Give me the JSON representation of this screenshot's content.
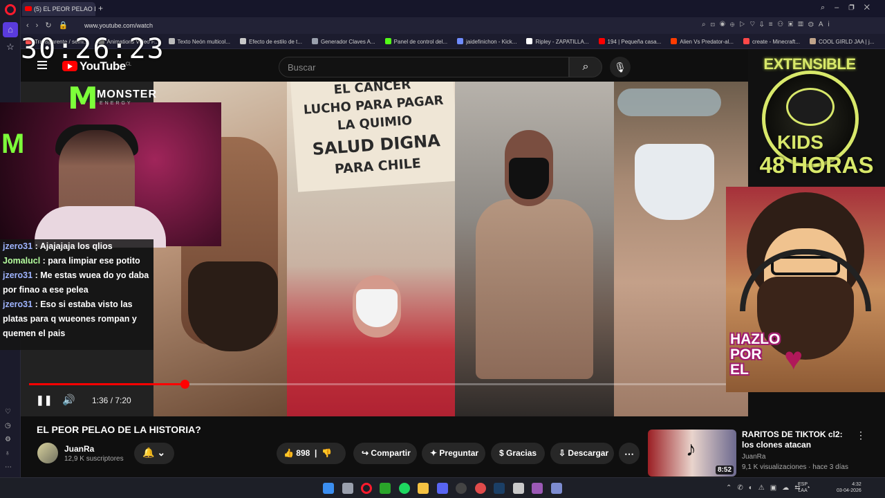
{
  "browser": {
    "tab_title": "(5) EL PEOR PELAO DE",
    "url": "www.youtube.com/watch",
    "bookmarks": [
      "Transparente / semi...",
      "Animations Video F...",
      "Texto Neón multicol...",
      "Efecto de estilo de t...",
      "Generador Claves A...",
      "Panel de control del...",
      "jaidefinichon - Kick...",
      "Ripley - ZAPATILLA...",
      "194 | Pequeña casa...",
      "Alien Vs Predator-al...",
      "create - Minecraft...",
      "COOL GIRLD JAA | j..."
    ],
    "ai_label": "Ai"
  },
  "stream": {
    "timer": "30:26:23",
    "monster_brand": "MONSTER",
    "monster_sub": "ENERGY",
    "chat": [
      {
        "user": "jzero31",
        "msg": "Ajajajaja los qlios"
      },
      {
        "user": "Jomalucl",
        "msg": "para limpiar ese potito"
      },
      {
        "user": "jzero31",
        "msg": "Me estas wuea do yo daba por finao a ese pelea"
      },
      {
        "user": "jzero31",
        "msg": "Eso si estaba visto las platas para q wueones rompan y quemen el pais"
      }
    ],
    "promo": {
      "top": "EXTENSIBLE",
      "middle": "KIDS",
      "bottom": "48 HORAS"
    },
    "hazlo": [
      "HAZLO",
      "POR",
      "EL"
    ]
  },
  "youtube": {
    "logo": "YouTube",
    "logo_country": "CL",
    "search_placeholder": "Buscar"
  },
  "video": {
    "sign_lines": [
      "EL CANCER",
      "LUCHO PARA PAGAR",
      "LA QUIMIO",
      "SALUD DIGNA",
      "PARA CHILE"
    ],
    "time": "1:36 / 7:20",
    "progress": 0.218,
    "title": "EL PEOR PELAO DE LA HISTORIA?",
    "channel": "JuanRa",
    "subscribers": "12,9 K suscriptores",
    "likes": "898",
    "share": "Compartir",
    "ask": "Preguntar",
    "thanks": "Gracias",
    "download": "Descargar"
  },
  "recommendation": {
    "title": "RARITOS DE TIKTOK cl2: los clones atacan",
    "channel": "JuanRa",
    "meta": "9,1 K visualizaciones · hace 3 días",
    "duration": "8:52"
  },
  "taskbar": {
    "lang1": "ESP",
    "lang2": "LAA",
    "time": "4:32",
    "date": "03-04-2026"
  },
  "colors": {
    "yt_red": "#ff0000",
    "monster_green": "#7dff3a",
    "promo_yellow": "#d8e86a",
    "opera_red": "#ff1b2d"
  }
}
